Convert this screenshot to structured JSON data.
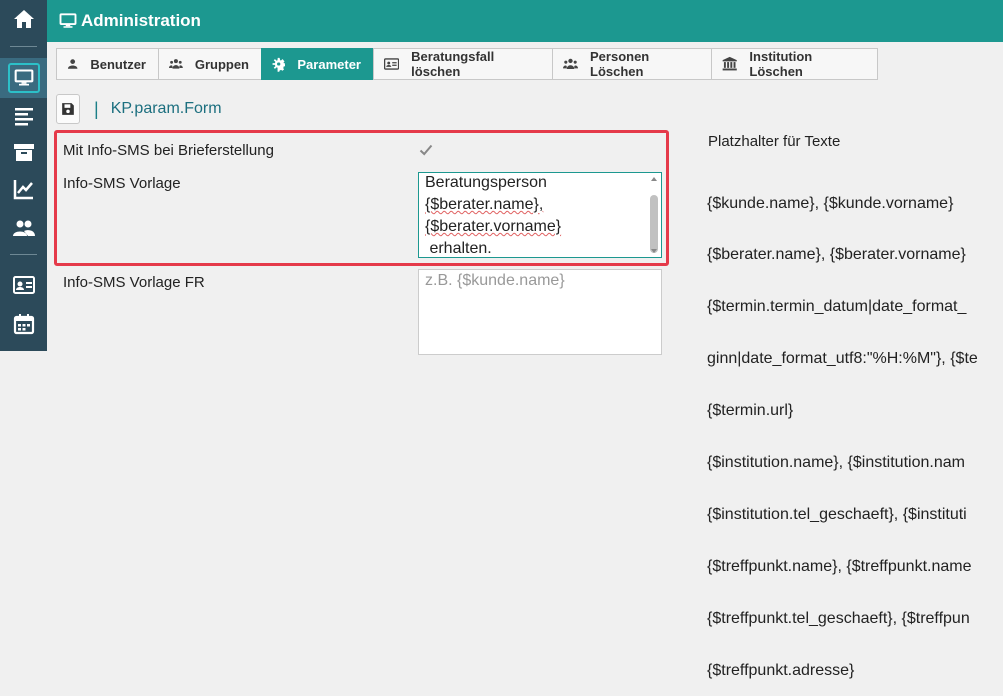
{
  "topbar": {
    "title": "Administration"
  },
  "sidebar": {
    "items": [
      {
        "icon": "home-icon"
      },
      {
        "icon": "monitor-icon"
      },
      {
        "icon": "list-icon"
      },
      {
        "icon": "archive-icon"
      },
      {
        "icon": "chart-icon"
      },
      {
        "icon": "users-icon"
      },
      {
        "icon": "id-card-icon"
      },
      {
        "icon": "calendar-icon"
      }
    ]
  },
  "tabs": [
    {
      "label": "Benutzer",
      "icon": "user-icon"
    },
    {
      "label": "Gruppen",
      "icon": "group-icon"
    },
    {
      "label": "Parameter",
      "icon": "gear-icon",
      "active": true
    },
    {
      "label": "Beratungsfall löschen",
      "icon": "id-card-icon"
    },
    {
      "label": "Personen Löschen",
      "icon": "group-icon"
    },
    {
      "label": "Institution Löschen",
      "icon": "institution-icon"
    }
  ],
  "form": {
    "name": "KP.param.Form",
    "separator": "|",
    "field1_label": "Mit Info-SMS bei Brieferstellung",
    "field1_checked": true,
    "field2_label": "Info-SMS Vorlage",
    "field2_lines": [
      "Beratungsperson",
      "{$berater.name},",
      "{$berater.vorname}",
      " erhalten."
    ],
    "field3_label": "Info-SMS Vorlage FR",
    "field3_placeholder": "z.B. {$kunde.name}"
  },
  "placeholders": {
    "title": "Platzhalter für Texte",
    "lines": [
      "{$kunde.name}, {$kunde.vorname}",
      "{$berater.name}, {$berater.vorname}",
      "{$termin.termin_datum|date_format_",
      "ginn|date_format_utf8:\"%H:%M\"}, {$te",
      "{$termin.url}",
      "{$institution.name}, {$institution.nam",
      "{$institution.tel_geschaeft}, {$instituti",
      "{$treffpunkt.name}, {$treffpunkt.name",
      "{$treffpunkt.tel_geschaeft}, {$treffpun",
      "{$treffpunkt.adresse}"
    ]
  },
  "colors": {
    "accent": "#1c9890",
    "sidebar": "#2c4a5a",
    "highlight": "#e53a4a"
  }
}
